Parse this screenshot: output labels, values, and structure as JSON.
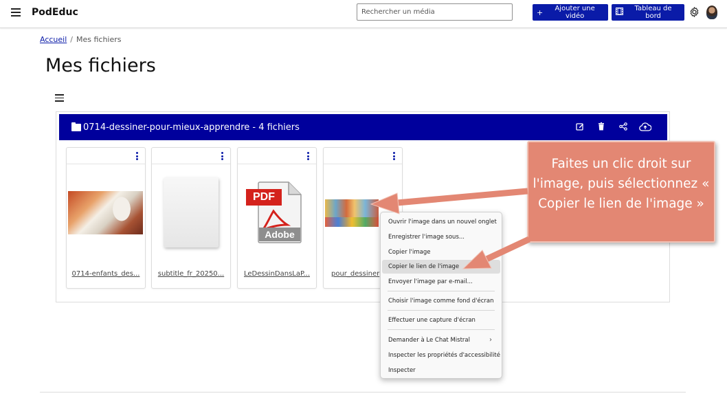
{
  "header": {
    "brand": "PodEduc",
    "search_placeholder": "Rechercher un média",
    "add_video_label": "Ajouter une vidéo",
    "dashboard_label": "Tableau de bord"
  },
  "breadcrumb": {
    "home": "Accueil",
    "current": "Mes fichiers"
  },
  "page_title": "Mes fichiers",
  "folder": {
    "title": "0714-dessiner-pour-mieux-apprendre - 4 fichiers",
    "actions": [
      "edit-icon",
      "trash-icon",
      "share-icon",
      "upload-cloud-icon"
    ]
  },
  "files": [
    {
      "name": "0714-enfants_des...",
      "thumb": "photo"
    },
    {
      "name": "subtitle_fr_20250...",
      "thumb": "document"
    },
    {
      "name": "LeDessinDansLaP...",
      "thumb": "pdf"
    },
    {
      "name": "pour_dessiner",
      "thumb": "illustration"
    }
  ],
  "pdf_icon": {
    "badge": "PDF",
    "label": "Adobe"
  },
  "context_menu": {
    "items": [
      "Ouvrir l'image dans un nouvel onglet",
      "Enregistrer l'image sous...",
      "Copier l'image",
      "Copier le lien de l'image",
      "Envoyer l'image par e-mail...",
      "Choisir l'image comme fond d'écran",
      "Effectuer une capture d'écran",
      "Demander à Le Chat Mistral",
      "Inspecter les propriétés d'accessibilité",
      "Inspecter"
    ],
    "highlighted": "Copier le lien de l'image"
  },
  "callout": {
    "text": "Faites un clic droit sur l'image, puis sélectionnez « Copier le lien de l'image »"
  },
  "colors": {
    "primary": "#0a1ba8",
    "folder_bar": "#00009c",
    "callout_bg": "#e38773",
    "callout_border": "#f1c2b5"
  }
}
